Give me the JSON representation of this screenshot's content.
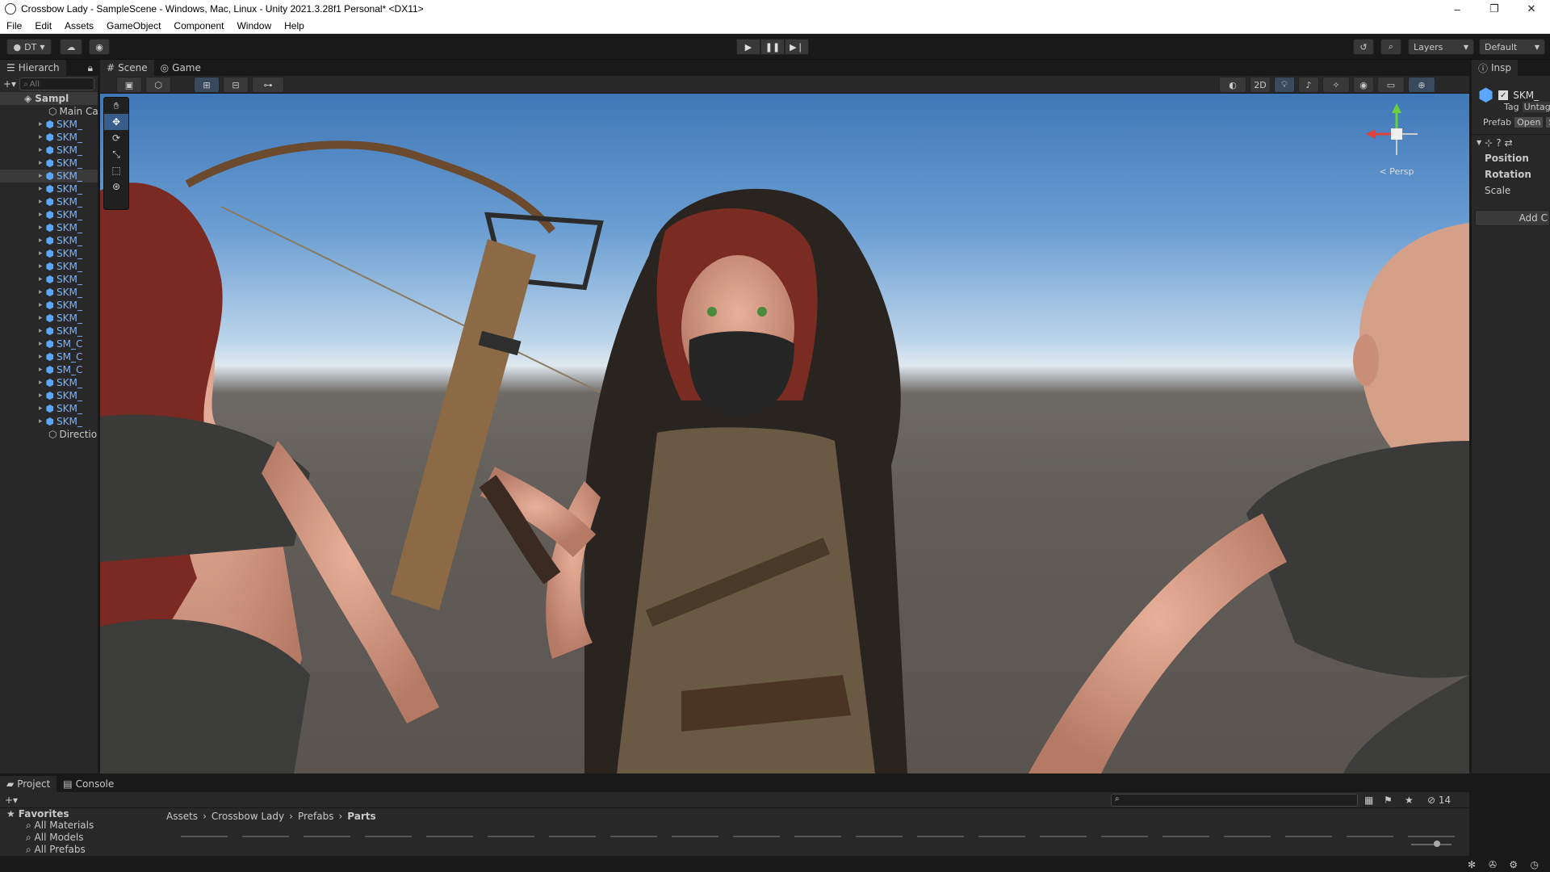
{
  "window": {
    "title": "Crossbow Lady - SampleScene - Windows, Mac, Linux - Unity 2021.3.28f1 Personal* <DX11>",
    "minimize": "–",
    "maximize": "❐",
    "close": "✕"
  },
  "menu": [
    "File",
    "Edit",
    "Assets",
    "GameObject",
    "Component",
    "Window",
    "Help"
  ],
  "toolbar": {
    "account_label": "DT",
    "layers_label": "Layers",
    "layout_label": "Default"
  },
  "hierarchy": {
    "tab_label": "Hierarch",
    "search_placeholder": "All",
    "scene_name": "Sampl",
    "items": [
      "Main Ca",
      "SKM_",
      "SKM_",
      "SKM_",
      "SKM_",
      "SKM_",
      "SKM_",
      "SKM_",
      "SKM_",
      "SKM_",
      "SKM_",
      "SKM_",
      "SKM_",
      "SKM_",
      "SKM_",
      "SKM_",
      "SKM_",
      "SKM_",
      "SM_C",
      "SM_C",
      "SM_C",
      "SKM_",
      "SKM_",
      "SKM_",
      "SKM_",
      "Directio"
    ]
  },
  "scene": {
    "tabs": [
      "Scene",
      "Game"
    ],
    "btn_2d": "2D",
    "persp_label": "< Persp"
  },
  "inspector": {
    "tab_label": "Insp",
    "object_name": "SKM_",
    "tag_label": "Tag",
    "tag_value": "Untag",
    "prefab_label": "Prefab",
    "prefab_open": "Open",
    "prefab_select": "S",
    "position_label": "Position",
    "rotation_label": "Rotation",
    "scale_label": "Scale",
    "add_component": "Add C"
  },
  "project": {
    "tabs": [
      "Project",
      "Console"
    ],
    "favorites_label": "Favorites",
    "favorites": [
      "All Materials",
      "All Models",
      "All Prefabs"
    ],
    "breadcrumb": [
      "Assets",
      "Crossbow Lady",
      "Prefabs",
      "Parts"
    ],
    "hidden_count": "14"
  }
}
